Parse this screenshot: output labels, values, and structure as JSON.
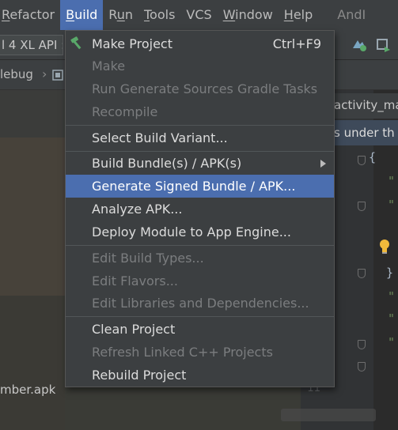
{
  "menubar": {
    "items": [
      {
        "label": "Refactor",
        "mnemonic": "R",
        "rest": "efactor"
      },
      {
        "label": "Build",
        "mnemonic": "B",
        "rest": "uild"
      },
      {
        "pre": "R",
        "mnemonic": "u",
        "rest": "n"
      },
      {
        "mnemonic": "T",
        "rest": "ools"
      },
      {
        "label": "VCS"
      },
      {
        "mnemonic": "W",
        "rest": "indow"
      },
      {
        "mnemonic": "H",
        "rest": "elp"
      }
    ],
    "app_title": "AndI"
  },
  "toolbar": {
    "device": "l 4 XL API :",
    "icons": [
      "build-variant-icon",
      "sdk-manager-icon",
      "device-manager-icon"
    ]
  },
  "breadcrumb": {
    "first": "lebug",
    "icon": "module-icon"
  },
  "editor": {
    "tab_label": "activity_ma",
    "banner_text": "s under th",
    "code_lines": [
      "{",
      "\"",
      "\"",
      "}",
      "\"",
      "\"",
      "\""
    ],
    "visible_line_number": "11"
  },
  "project_panel": {
    "file_label": "mber.apk"
  },
  "build_menu": {
    "items": [
      {
        "label": "Make Project",
        "shortcut": "Ctrl+F9",
        "enabled": true,
        "icon": "hammer-icon"
      },
      {
        "label": "Make",
        "enabled": false
      },
      {
        "label": "Run Generate Sources Gradle Tasks",
        "enabled": false
      },
      {
        "label": "Recompile",
        "enabled": false
      },
      {
        "label": "Select Build Variant...",
        "enabled": true
      },
      {
        "label": "Build Bundle(s) / APK(s)",
        "enabled": true,
        "submenu": true
      },
      {
        "label": "Generate Signed Bundle / APK...",
        "enabled": true,
        "selected": true
      },
      {
        "label": "Analyze APK...",
        "enabled": true
      },
      {
        "label": "Deploy Module to App Engine...",
        "enabled": true
      },
      {
        "label": "Edit Build Types...",
        "enabled": false
      },
      {
        "label": "Edit Flavors...",
        "enabled": false
      },
      {
        "label": "Edit Libraries and Dependencies...",
        "enabled": false
      },
      {
        "label": "Clean Project",
        "enabled": true
      },
      {
        "label": "Refresh Linked C++ Projects",
        "enabled": false
      },
      {
        "label": "Rebuild Project",
        "enabled": true
      }
    ]
  },
  "colors": {
    "menu_bg": "#3c3f41",
    "selection": "#4b6eaf",
    "text": "#dcdcdc",
    "disabled_text": "#7b7d7f",
    "editor_bg": "#2b2b2b"
  }
}
